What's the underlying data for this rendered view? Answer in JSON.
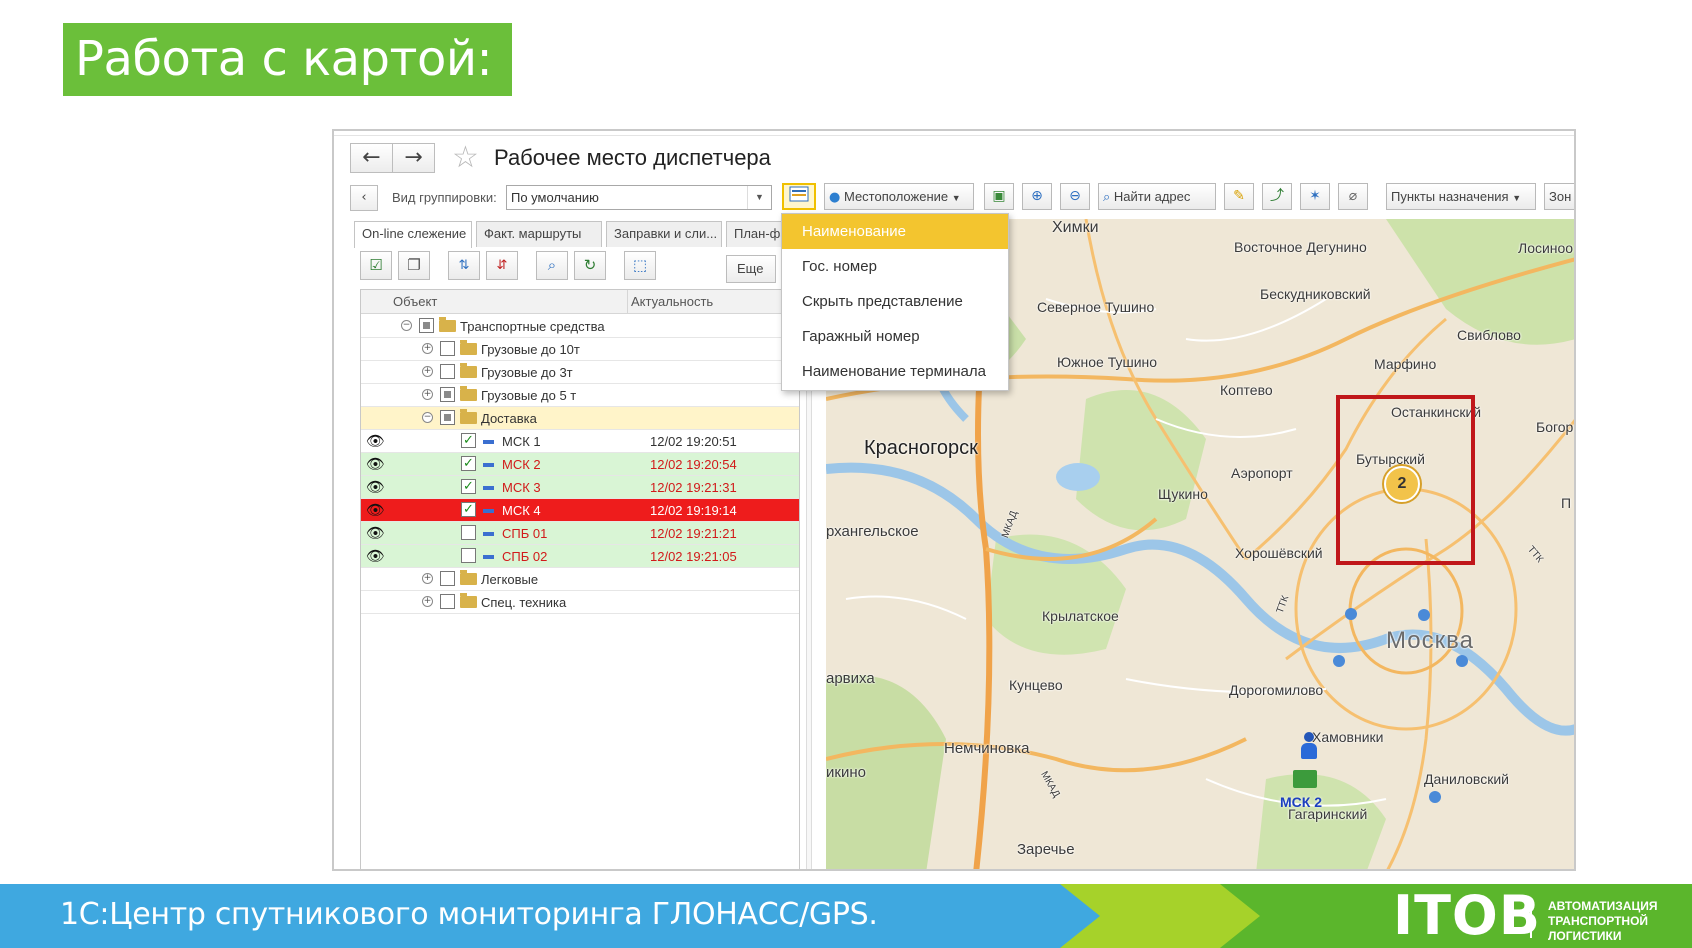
{
  "slide": {
    "title": "Работа с картой:",
    "footer_text": "1С:Центр спутникового мониторинга ГЛОНАСС/GPS.",
    "logo": "ITOB",
    "logo_sub": [
      "АВТОМАТИЗАЦИЯ",
      "ТРАНСПОРТНОЙ",
      "ЛОГИСТИКИ"
    ]
  },
  "window": {
    "title": "Рабочее место диспетчера",
    "back_icon": "←",
    "forward_icon": "→",
    "star_icon": "☆"
  },
  "toolbar": {
    "grouping_label": "Вид группировки:",
    "grouping_value": "По умолчанию",
    "location_button": "Местоположение",
    "find_address_button": "Найти адрес",
    "destinations_button": "Пункты назначения",
    "zones_button": "Зон"
  },
  "tabs": [
    "On-line слежение",
    "Факт. маршруты",
    "Заправки и сли...",
    "План-фа"
  ],
  "tree": {
    "more_button": "Еще",
    "columns": {
      "object": "Объект",
      "actuality": "Актуальность"
    },
    "rows": [
      {
        "name": "Транспортные средства",
        "time": ""
      },
      {
        "name": "Грузовые до 10т",
        "time": ""
      },
      {
        "name": "Грузовые до 3т",
        "time": ""
      },
      {
        "name": "Грузовые до 5 т",
        "time": ""
      },
      {
        "name": "Доставка",
        "time": ""
      },
      {
        "name": "МСК 1",
        "time": "12/02 19:20:51"
      },
      {
        "name": "МСК 2",
        "time": "12/02 19:20:54"
      },
      {
        "name": "МСК 3",
        "time": "12/02 19:21:31"
      },
      {
        "name": "МСК 4",
        "time": "12/02 19:19:14"
      },
      {
        "name": "СПБ 01",
        "time": "12/02 19:21:21"
      },
      {
        "name": "СПБ 02",
        "time": "12/02 19:21:05"
      },
      {
        "name": "Легковые",
        "time": ""
      },
      {
        "name": "Спец. техника",
        "time": ""
      }
    ]
  },
  "dropdown": {
    "items": [
      "Наименование",
      "Гос. номер",
      "Скрыть представление",
      "Гаражный номер",
      "Наименование терминала"
    ],
    "selected": "Наименование"
  },
  "map": {
    "labels": {
      "khimki": "Химки",
      "vost_degunino": "Восточное Дегунино",
      "losinoo": "Лосиноо",
      "beskudnikovsky": "Бескудниковский",
      "sev_tushino": "Северное Тушино",
      "sviblovo": "Свиблово",
      "yuzh_tushino": "Южное Тушино",
      "marfino": "Марфино",
      "koptevo": "Коптево",
      "ostankinsky": "Останкинский",
      "bogor": "Богор",
      "krasnogorsk": "Красногорск",
      "butyrsky": "Бутырский",
      "aeroport": "Аэропорт",
      "shchukino": "Щукино",
      "p": "П",
      "arkhangelskoe": "рхангельское",
      "khoroshevsky": "Хорошёвский",
      "krylatskoe": "Крылатское",
      "moskva": "Москва",
      "barvikha": "арвиха",
      "kuntsevo": "Кунцево",
      "dorogomilovo": "Дорогомилово",
      "khamovniki": "Хамовники",
      "nemchinovka": "Немчиновка",
      "danilovsky": "Даниловский",
      "ikino": "икино",
      "gagarinsky": "Гагаринский",
      "zarechye": "Заречье",
      "mkad1": "МКАД",
      "mkad2": "МКАД",
      "ttk1": "ТТК",
      "ttk2": "ТТК"
    },
    "cluster_count": "2",
    "vehicle_label": "МСК 2"
  }
}
